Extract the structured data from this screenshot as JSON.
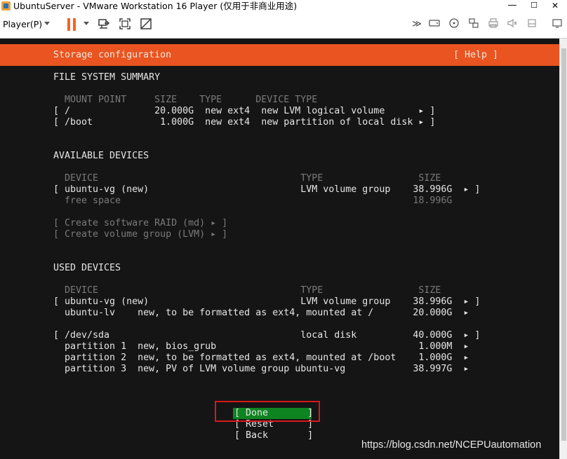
{
  "window": {
    "title": "UbuntuServer - VMware Workstation 16 Player (仅用于非商业用途)",
    "minimize": "—",
    "maximize": "☐",
    "close": "✕"
  },
  "toolbar": {
    "player_menu": "Player(P)",
    "icons": [
      "pause-icon",
      "send-ctrl-alt-del-icon",
      "fullscreen-icon",
      "unity-icon",
      "forward-icon",
      "hard-disk-icon",
      "cd-icon",
      "network-icon",
      "printer-icon",
      "sound-icon",
      "usb-icon",
      "display-icon"
    ]
  },
  "installer": {
    "header_title": "Storage configuration",
    "help": "[ Help ]",
    "fs_summary_title": "FILE SYSTEM SUMMARY",
    "fs_columns": "  MOUNT POINT     SIZE    TYPE      DEVICE TYPE",
    "fs_rows": [
      "[ /               20.000G  new ext4  new LVM logical volume      ▸ ]",
      "[ /boot            1.000G  new ext4  new partition of local disk ▸ ]"
    ],
    "available_title": "AVAILABLE DEVICES",
    "available_columns": "  DEVICE                                    TYPE                 SIZE",
    "available_rows": [
      "[ ubuntu-vg (new)                           LVM volume group    38.996G  ▸ ]"
    ],
    "free_space": "  free space                                                    18.996G",
    "create_raid": "[ Create software RAID (md) ▸ ]",
    "create_vg": "[ Create volume group (LVM) ▸ ]",
    "used_title": "USED DEVICES",
    "used_columns": "  DEVICE                                    TYPE                 SIZE",
    "used_rows": [
      "[ ubuntu-vg (new)                           LVM volume group    38.996G  ▸ ]",
      "  ubuntu-lv    new, to be formatted as ext4, mounted at /       20.000G  ▸",
      "",
      "[ /dev/sda                                  local disk          40.000G  ▸ ]",
      "  partition 1  new, bios_grub                                    1.000M  ▸",
      "  partition 2  new, to be formatted as ext4, mounted at /boot    1.000G  ▸",
      "  partition 3  new, PV of LVM volume group ubuntu-vg            38.997G  ▸"
    ],
    "done_button": "[ Done       ]",
    "reset_button": "[ Reset      ]",
    "back_button": "[ Back       ]"
  },
  "watermark": "https://blog.csdn.net/NCEPUautomation",
  "colors": {
    "header": "#e95420",
    "done_highlight": "#0e8420",
    "annotation_box": "#d7191c",
    "screen_bg": "#151515"
  }
}
